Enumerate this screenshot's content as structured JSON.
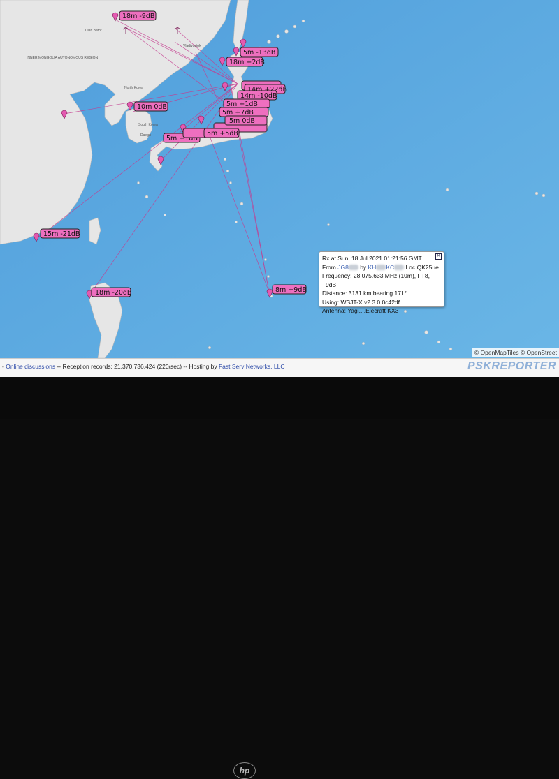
{
  "map": {
    "spots": [
      {
        "label": "18m -9dB"
      },
      {
        "label": "5m -13dB"
      },
      {
        "label": "18m +2dB"
      },
      {
        "label": "14m +22dB"
      },
      {
        "label": "14m -10dB"
      },
      {
        "label": "5m +1dB"
      },
      {
        "label": "5m +7dB"
      },
      {
        "label": "5m 0dB"
      },
      {
        "label": "10m 0dB"
      },
      {
        "label": "5m +1dB"
      },
      {
        "label": "5m +5dB"
      },
      {
        "label": "15m -21dB"
      },
      {
        "label": "18m -20dB"
      },
      {
        "label": "8m +9dB"
      }
    ],
    "places": [
      "INNER MONGOLIA AUTONOMOUS REGION",
      "North Korea",
      "South Korea",
      "Ulan Bator",
      "Daegu",
      "Vladivostok"
    ]
  },
  "popup": {
    "close": "✕",
    "line1": "Rx at Sun, 18 Jul 2021 01:21:56 GMT",
    "from_prefix": "From",
    "from_call": "JG8",
    "by_text": "by",
    "by_call": "KH",
    "by_call_tail": "KC",
    "loc": "Loc QK25ue",
    "freq": "Frequency: 28.075.633 MHz (10m), FT8, +9dB",
    "distance": "Distance: 3131 km bearing 171°",
    "using": "Using: WSJT-X v2.3.0 0c42df",
    "antenna": "Antenna: Yagi....Elecraft KX3"
  },
  "attribution": {
    "omt": "© OpenMapTiles",
    "osm": "© OpenStreet"
  },
  "footer": {
    "discussions_link": "Online discussions",
    "reception": "-- Reception records: 21,370,736,424 (220/sec) -- Hosting by",
    "host_link": "Fast Serv Networks, LLC",
    "logo": "PSKREPORTER"
  },
  "device": {
    "logo": "hp"
  },
  "colors": {
    "sea": "#5aa8e0",
    "land": "#e4e4e4",
    "spot": "#e35ab0",
    "path": "#c43b8f"
  }
}
